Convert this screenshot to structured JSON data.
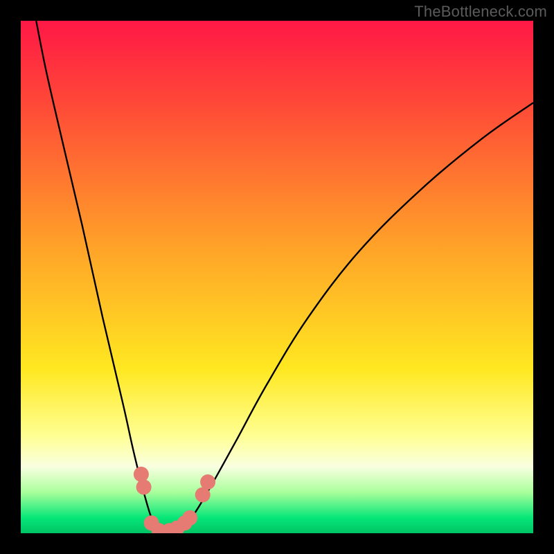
{
  "watermark": "TheBottleneck.com",
  "colors": {
    "black": "#000000",
    "curve": "#000000",
    "dot": "#e57b73",
    "top_red": "#ff1846",
    "mid_red": "#ff4538",
    "orange": "#ffa528",
    "yellow": "#ffe821",
    "pale_yellow": "#ffff93",
    "whitish": "#f9ffe0",
    "light_green": "#a9ff9c",
    "green": "#06e678",
    "deep_green": "#00c464"
  },
  "chart_data": {
    "type": "line",
    "title": "",
    "xlabel": "",
    "ylabel": "",
    "xlim": [
      0,
      100
    ],
    "ylim": [
      0,
      100
    ],
    "series": [
      {
        "name": "bottleneck-curve",
        "x": [
          3,
          5,
          8,
          12,
          16,
          20,
          22,
          24,
          25.5,
          27,
          28.5,
          30,
          32,
          34,
          37,
          42,
          48,
          56,
          66,
          78,
          90,
          100
        ],
        "y": [
          100,
          90,
          77,
          60,
          42,
          25,
          16,
          8,
          3,
          0,
          0,
          0.5,
          1.5,
          4,
          9,
          18,
          29,
          42,
          55,
          67,
          77,
          84
        ]
      }
    ],
    "markers": [
      {
        "x": 23.5,
        "y": 11.5
      },
      {
        "x": 24.0,
        "y": 9.0
      },
      {
        "x": 25.5,
        "y": 2.0
      },
      {
        "x": 27.0,
        "y": 0.5
      },
      {
        "x": 29.0,
        "y": 0.5
      },
      {
        "x": 30.5,
        "y": 1.0
      },
      {
        "x": 32.0,
        "y": 2.0
      },
      {
        "x": 33.0,
        "y": 3.0
      },
      {
        "x": 35.5,
        "y": 7.5
      },
      {
        "x": 36.5,
        "y": 10.0
      }
    ],
    "gradient_stops": [
      {
        "pos": 0.0,
        "color": "#ff1846"
      },
      {
        "pos": 0.15,
        "color": "#ff4538"
      },
      {
        "pos": 0.45,
        "color": "#ffa528"
      },
      {
        "pos": 0.68,
        "color": "#ffe821"
      },
      {
        "pos": 0.81,
        "color": "#ffff93"
      },
      {
        "pos": 0.87,
        "color": "#f9ffe0"
      },
      {
        "pos": 0.92,
        "color": "#a9ff9c"
      },
      {
        "pos": 0.97,
        "color": "#06e678"
      },
      {
        "pos": 1.0,
        "color": "#00c464"
      }
    ]
  }
}
